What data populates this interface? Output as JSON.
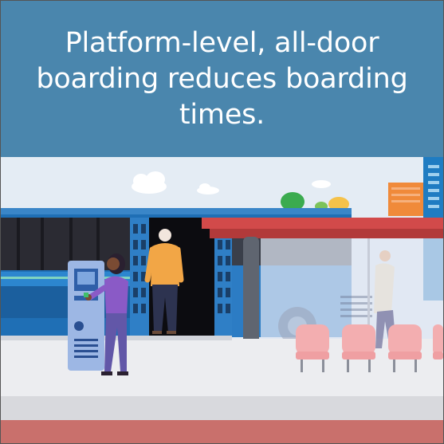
{
  "banner": {
    "title": "Platform-level, all-door boarding reduces boarding times.",
    "background_color": "#4a86ad",
    "text_color": "#ffffff"
  },
  "scene": {
    "sky_color": "#e4ecf4",
    "bus_color": "#1f6fb5",
    "shelter_roof_color": "#d24a4a",
    "platform_color": "#e6e6ea",
    "curb_color": "#c9706c",
    "icons": [
      "ticket-machine-icon",
      "bus-icon",
      "shelter-icon",
      "bench-icon",
      "person-icon",
      "cloud-icon",
      "tree-icon"
    ]
  }
}
